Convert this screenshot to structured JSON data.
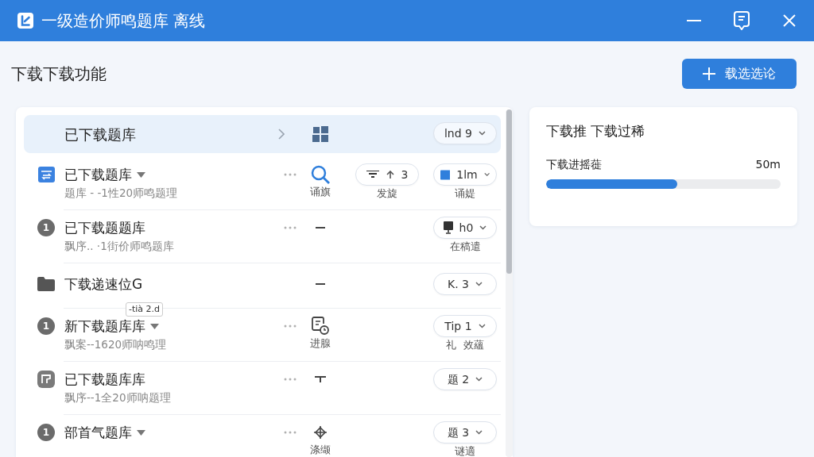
{
  "window": {
    "title": "一级造价师鸣题库 离线"
  },
  "header": {
    "title": "下载下载功能",
    "action": "载选选论"
  },
  "list": {
    "section": {
      "title": "已下载题库",
      "dropdown": "lnd 9"
    },
    "rows": [
      {
        "kind": "file",
        "title": "已下载题库",
        "caret": true,
        "subtitle": "题库 - -1性20师鸣题理",
        "more": true,
        "middle": {
          "kind": "search",
          "label": "诵旗"
        },
        "filter": {
          "text": "3",
          "label": "发旋"
        },
        "dropdown": {
          "kind": "swatch",
          "text": "1lm",
          "label": "诵媞"
        }
      },
      {
        "kind": "number",
        "number": "1",
        "title": "已下载题题库",
        "caret": false,
        "subtitle": "飘序.. ·1街价师鸣题库",
        "more": true,
        "middle": {
          "kind": "dash"
        },
        "dropdown": {
          "kind": "monitor",
          "text": "h0",
          "label": "在稿遣"
        }
      },
      {
        "kind": "folder",
        "title": "下载递速位G",
        "caret": false,
        "more": false,
        "middle": {
          "kind": "dash"
        },
        "dropdown": {
          "kind": "plain",
          "text": "K. 3"
        }
      },
      {
        "kind": "number",
        "number": "1",
        "tag": "-tià 2.d",
        "title": "新下载题库库",
        "caret": true,
        "subtitle": "飘案--1620师呐鸣理",
        "more": true,
        "middle": {
          "kind": "document",
          "label": "进腺"
        },
        "dropdown": {
          "kind": "plain",
          "text": "Tip 1",
          "label": "礼  效蘊"
        }
      },
      {
        "kind": "picture",
        "title": "已下载题库库",
        "caret": false,
        "subtitle": "飘序--1全20师呐题理",
        "more": true,
        "middle": {
          "kind": "tee"
        },
        "dropdown": {
          "kind": "plain",
          "text": "题 2"
        }
      },
      {
        "kind": "number",
        "number": "1",
        "title": "部首气题库",
        "caret": true,
        "more": true,
        "middle": {
          "kind": "crosshair",
          "label": "涤缬"
        },
        "dropdown": {
          "kind": "plain",
          "text": "题 3",
          "label": "谜適"
        }
      }
    ]
  },
  "panel": {
    "title": "下载推 下载过稀",
    "progress": {
      "label": "下载进摇蓰",
      "value": "50m",
      "level": 0.56
    }
  }
}
